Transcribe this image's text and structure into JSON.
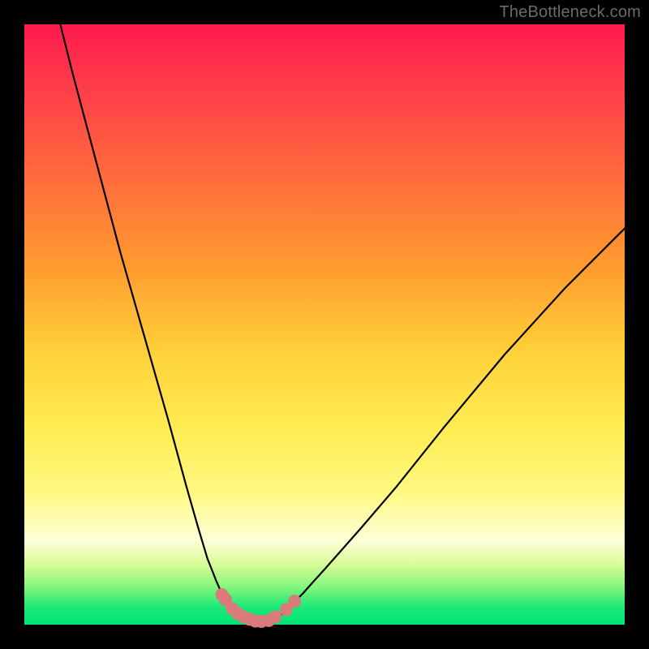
{
  "watermark": "TheBottleneck.com",
  "chart_data": {
    "type": "line",
    "title": "",
    "xlabel": "",
    "ylabel": "",
    "xlim": [
      0,
      100
    ],
    "ylim": [
      0,
      100
    ],
    "grid": false,
    "series": [
      {
        "name": "left-curve",
        "x": [
          6,
          8,
          12,
          16,
          20,
          24,
          27,
          29,
          30.5,
          31.3,
          32,
          32.8,
          33.2,
          33.6,
          34,
          34.5,
          35,
          35.6,
          36.3,
          37.2,
          38.2,
          39.2
        ],
        "values": [
          100,
          92,
          77,
          62,
          48,
          34,
          23,
          16,
          11,
          9,
          7.2,
          5.4,
          4.6,
          4,
          3.4,
          2.8,
          2.2,
          1.6,
          1.2,
          0.7,
          0.35,
          0.2
        ]
      },
      {
        "name": "right-curve",
        "x": [
          39.2,
          40.5,
          41.8,
          43.2,
          44.2,
          45.2,
          46.4,
          48,
          50,
          56,
          62,
          70,
          80,
          90,
          100
        ],
        "values": [
          0.2,
          0.5,
          1,
          2,
          3,
          4,
          5.2,
          7,
          9.2,
          16,
          23,
          33,
          45,
          56,
          66
        ]
      },
      {
        "name": "dots",
        "type": "scatter",
        "color": "#d97b7b",
        "x": [
          32.9,
          33.5,
          34.6,
          35.5,
          36.5,
          37.5,
          38.5,
          39.5,
          40.7,
          41.8,
          43.6,
          45.0
        ],
        "values": [
          5.0,
          4.2,
          2.7,
          1.9,
          1.3,
          0.9,
          0.6,
          0.55,
          0.7,
          1.3,
          2.5,
          3.9
        ]
      }
    ]
  }
}
